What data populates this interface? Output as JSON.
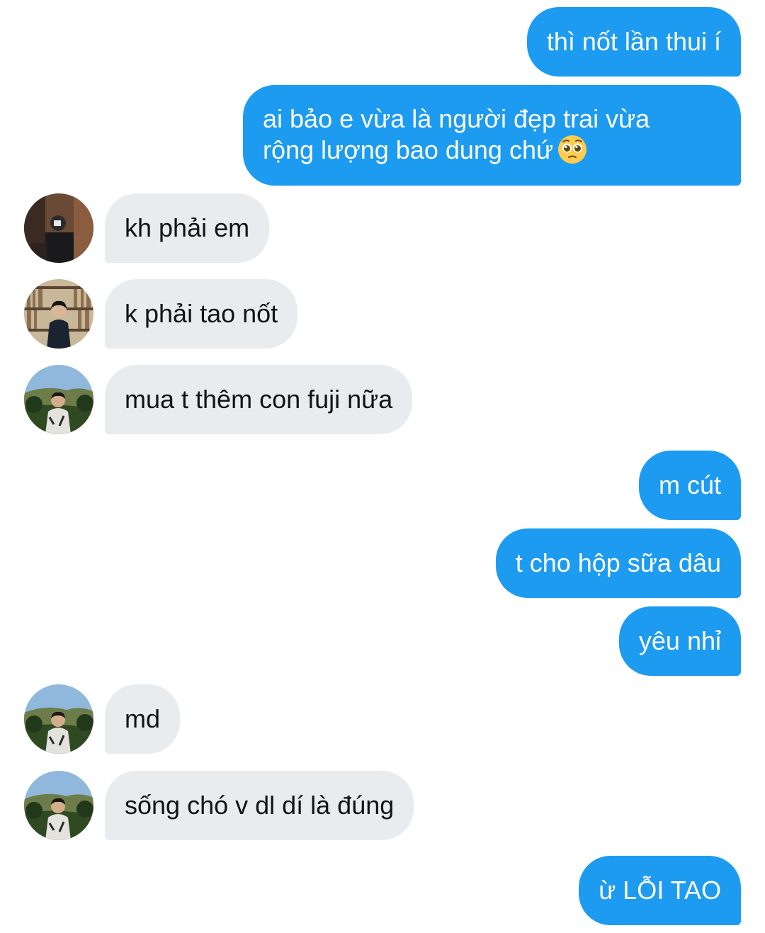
{
  "messages": [
    {
      "from": "me",
      "text": "thì nốt lần thui í"
    },
    {
      "from": "me",
      "lines": [
        "ai bảo e vừa là người đẹp trai vừa",
        "rộng lượng bao dung chứ"
      ],
      "emoji": "pleading-face-emoji"
    },
    {
      "from": "them",
      "text": "kh phải em",
      "avatar": "avatar-dark-room"
    },
    {
      "from": "them",
      "text": "k phải tao nốt",
      "avatar": "avatar-bookshelf"
    },
    {
      "from": "them",
      "text": "mua t thêm con fuji nữa",
      "avatar": "avatar-outdoor"
    },
    {
      "from": "me",
      "text": "m cút"
    },
    {
      "from": "me",
      "text": "t cho hộp sữa dâu"
    },
    {
      "from": "me",
      "text": "yêu nhỉ"
    },
    {
      "from": "them",
      "text": "md",
      "avatar": "avatar-outdoor"
    },
    {
      "from": "them",
      "text": "sống chó v dl dí là đúng",
      "avatar": "avatar-outdoor"
    },
    {
      "from": "me",
      "text": "ừ LỖI TAO"
    }
  ],
  "colors": {
    "outgoing_bubble": "#1d9bf0",
    "outgoing_text": "#ffffff",
    "incoming_bubble": "#e8ecef",
    "incoming_text": "#0f1419",
    "background": "#ffffff"
  }
}
